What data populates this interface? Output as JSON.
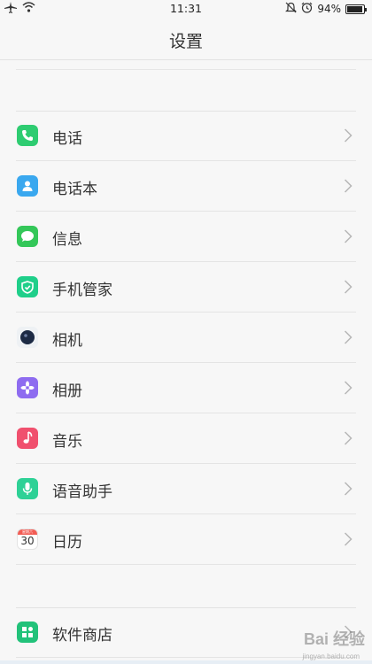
{
  "status_bar": {
    "time": "11:31",
    "battery_text": "94%",
    "battery_level": 0.94,
    "icons": [
      "airplane-icon",
      "wifi-icon",
      "mute-bell-icon",
      "alarm-icon",
      "battery-icon"
    ]
  },
  "header": {
    "title": "设置"
  },
  "group_apps": {
    "items": [
      {
        "label": "电话",
        "icon": "phone-icon",
        "color": "#2ecc71"
      },
      {
        "label": "电话本",
        "icon": "contacts-icon",
        "color": "#3aa8ef"
      },
      {
        "label": "信息",
        "icon": "message-icon",
        "color": "#34c759"
      },
      {
        "label": "手机管家",
        "icon": "shield-icon",
        "color": "#1fcf8a"
      },
      {
        "label": "相机",
        "icon": "camera-icon",
        "color": "#1c2a44"
      },
      {
        "label": "相册",
        "icon": "album-icon",
        "color": "#8e6cf0"
      },
      {
        "label": "音乐",
        "icon": "music-icon",
        "color": "#f0506e"
      },
      {
        "label": "语音助手",
        "icon": "microphone-icon",
        "color": "#2ed196"
      },
      {
        "label": "日历",
        "icon": "calendar-icon",
        "color": "#f25c54",
        "calendar_day": "30",
        "calendar_month": "星期六"
      }
    ]
  },
  "group_store": {
    "items": [
      {
        "label": "软件商店",
        "icon": "store-icon",
        "color": "#22c27a"
      }
    ]
  },
  "watermark": {
    "text": "Bai 经验",
    "sub": "jingyan.baidu.com"
  }
}
